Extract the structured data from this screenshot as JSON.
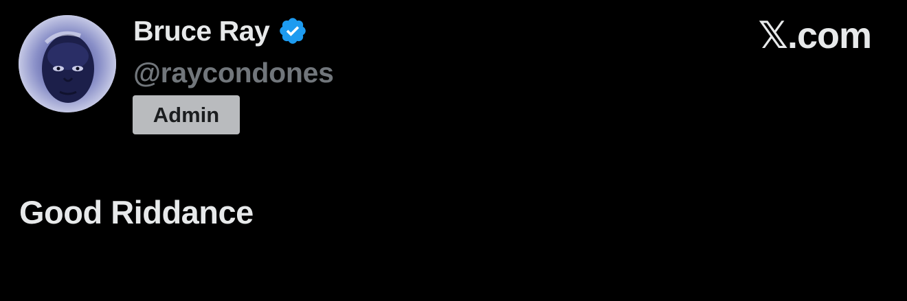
{
  "author": {
    "display_name": "Bruce Ray",
    "handle": "@raycondones",
    "verified": true,
    "verified_badge_color": "#1d9bf0",
    "role_badge": "Admin",
    "avatar_icon": "profile-photo"
  },
  "site": {
    "label": "𝕏.com"
  },
  "tweet": {
    "text": "Good Riddance"
  },
  "colors": {
    "background": "#000000",
    "primary_text": "#e7e9ea",
    "secondary_text": "#71767b",
    "badge_background": "#b9bbbe"
  }
}
